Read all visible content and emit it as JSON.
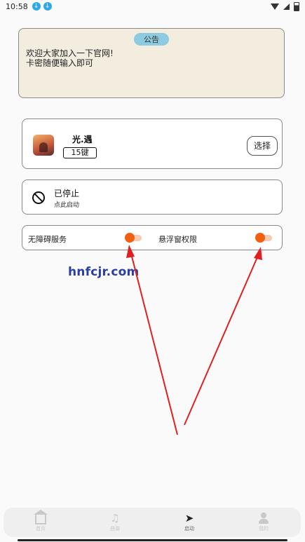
{
  "status_bar": {
    "time": "10:58",
    "icons": [
      "download-icon",
      "download-icon",
      "wifi-icon",
      "signal-icon",
      "battery-icon"
    ]
  },
  "notice": {
    "badge": "公告",
    "text": "欢迎大家加入一下官网!\n卡密随便输入即可"
  },
  "game": {
    "name": "光.遇",
    "keys": "15键",
    "select_label": "选择"
  },
  "service_status": {
    "title": "已停止",
    "subtitle": "点此启动"
  },
  "permissions": {
    "accessibility_label": "无障碍服务",
    "accessibility_on": true,
    "overlay_label": "悬浮窗权限",
    "overlay_on": true
  },
  "watermark": "hnfcjr.com",
  "bottom_nav": {
    "items": [
      {
        "label": "首页",
        "icon": "home-icon"
      },
      {
        "label": "曲谱",
        "icon": "music-icon"
      },
      {
        "label": "启动",
        "icon": "send-icon"
      },
      {
        "label": "我的",
        "icon": "person-icon"
      }
    ],
    "active_index": 2
  },
  "colors": {
    "accent": "#f06010",
    "notice_bg": "#f3ede0",
    "badge_bg": "#8ccbe0",
    "annotation_arrow": "#e02020"
  }
}
